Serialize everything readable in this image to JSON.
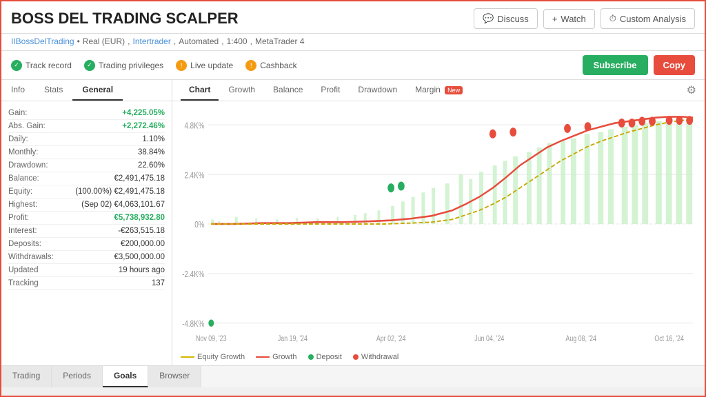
{
  "header": {
    "title": "BOSS DEL TRADING SCALPER",
    "discuss_label": "Discuss",
    "watch_label": "Watch",
    "custom_analysis_label": "Custom Analysis"
  },
  "subtitle": {
    "username": "IIBossDelTrading",
    "account_type": "Real (EUR)",
    "broker": "Intertrader",
    "mode": "Automated",
    "leverage": "1:400",
    "platform": "MetaTrader 4"
  },
  "status_bar": {
    "items": [
      {
        "label": "Track record",
        "icon": "green"
      },
      {
        "label": "Trading privileges",
        "icon": "green"
      },
      {
        "label": "Live update",
        "icon": "yellow"
      },
      {
        "label": "Cashback",
        "icon": "yellow"
      }
    ],
    "subscribe_label": "Subscribe",
    "copy_label": "Copy"
  },
  "left_panel": {
    "tabs": [
      "Info",
      "Stats",
      "General"
    ],
    "active_tab": "General",
    "stats": [
      {
        "label": "Gain:",
        "value": "+4,225.05%",
        "type": "green"
      },
      {
        "label": "Abs. Gain:",
        "value": "+2,272.46%",
        "type": "green"
      },
      {
        "label": "Daily:",
        "value": "1.10%",
        "type": "normal"
      },
      {
        "label": "Monthly:",
        "value": "38.84%",
        "type": "normal"
      },
      {
        "label": "Drawdown:",
        "value": "22.60%",
        "type": "normal"
      },
      {
        "label": "Balance:",
        "value": "€2,491,475.18",
        "type": "normal"
      },
      {
        "label": "Equity:",
        "value": "(100.00%) €2,491,475.18",
        "type": "normal"
      },
      {
        "label": "Highest:",
        "value": "(Sep 02) €4,063,101.67",
        "type": "normal"
      },
      {
        "label": "Profit:",
        "value": "€5,738,932.80",
        "type": "green"
      },
      {
        "label": "Interest:",
        "value": "-€263,515.18",
        "type": "normal"
      },
      {
        "label": "Deposits:",
        "value": "€200,000.00",
        "type": "normal"
      },
      {
        "label": "Withdrawals:",
        "value": "€3,500,000.00",
        "type": "normal"
      },
      {
        "label": "Updated",
        "value": "19 hours ago",
        "type": "normal"
      },
      {
        "label": "Tracking",
        "value": "137",
        "type": "normal"
      }
    ]
  },
  "chart_panel": {
    "tabs": [
      "Chart",
      "Growth",
      "Balance",
      "Profit",
      "Drawdown",
      "Margin"
    ],
    "active_tab": "Chart",
    "new_badge": "New",
    "margin_has_badge": true,
    "legend": [
      {
        "label": "Equity Growth",
        "type": "yellow_line"
      },
      {
        "label": "Growth",
        "type": "red_line"
      },
      {
        "label": "Deposit",
        "type": "green_dot"
      },
      {
        "label": "Withdrawal",
        "type": "red_dot"
      }
    ],
    "x_labels": [
      "Nov 09, '23",
      "Jan 19, '24",
      "Apr 02, '24",
      "Jun 04, '24",
      "Aug 08, '24",
      "Oct 16, '24"
    ],
    "y_labels": [
      "4.8K%",
      "2.4K%",
      "0%",
      "-2.4K%",
      "-4.8K%"
    ]
  },
  "bottom_tabs": {
    "tabs": [
      "Trading",
      "Periods",
      "Goals",
      "Browser"
    ],
    "active_tab": "Goals"
  }
}
